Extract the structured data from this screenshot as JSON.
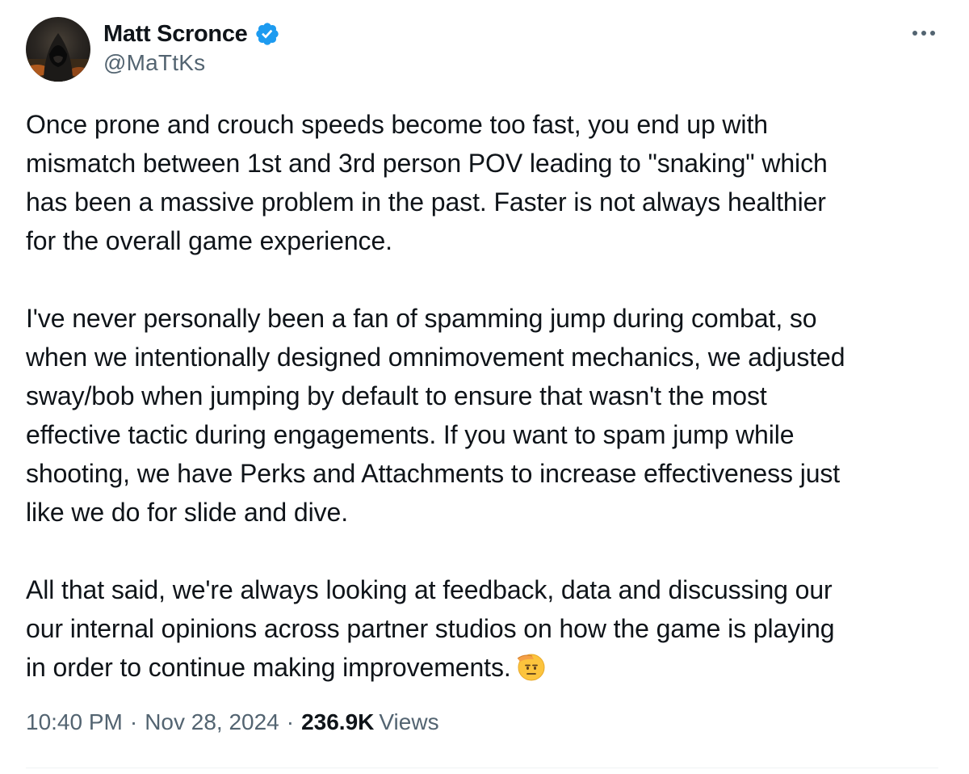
{
  "author": {
    "name": "Matt Scronce",
    "handle": "@MaTtKs",
    "verified": true,
    "verified_badge_color": "#1d9bf0"
  },
  "menu": {
    "more_icon": "more-horizontal-icon"
  },
  "tweet": {
    "paragraphs": [
      "Once prone and crouch speeds become too fast, you end up with\nmismatch between 1st and 3rd person POV leading to \"snaking\" which\nhas been a massive problem in the past. Faster is not always healthier\nfor the overall game experience.",
      "I've never personally been a fan of spamming jump during combat, so\nwhen we intentionally designed omnimovement mechanics, we adjusted\nsway/bob when jumping by default to ensure that wasn't the most\neffective tactic during engagements. If you want to spam jump while\nshooting, we have Perks and Attachments to increase effectiveness just\nlike we do for slide and dive.",
      "All that said, we're always looking at feedback, data and discussing our\nour internal opinions across partner studios on how the game is playing\nin order to continue making improvements."
    ],
    "emoji": "saluting-face-emoji"
  },
  "meta": {
    "time": "10:40 PM",
    "separator": "·",
    "date": "Nov 28, 2024",
    "views_count": "236.9K",
    "views_label": "Views"
  },
  "colors": {
    "text": "#0f1419",
    "secondary": "#536471",
    "divider": "#eff3f4"
  }
}
